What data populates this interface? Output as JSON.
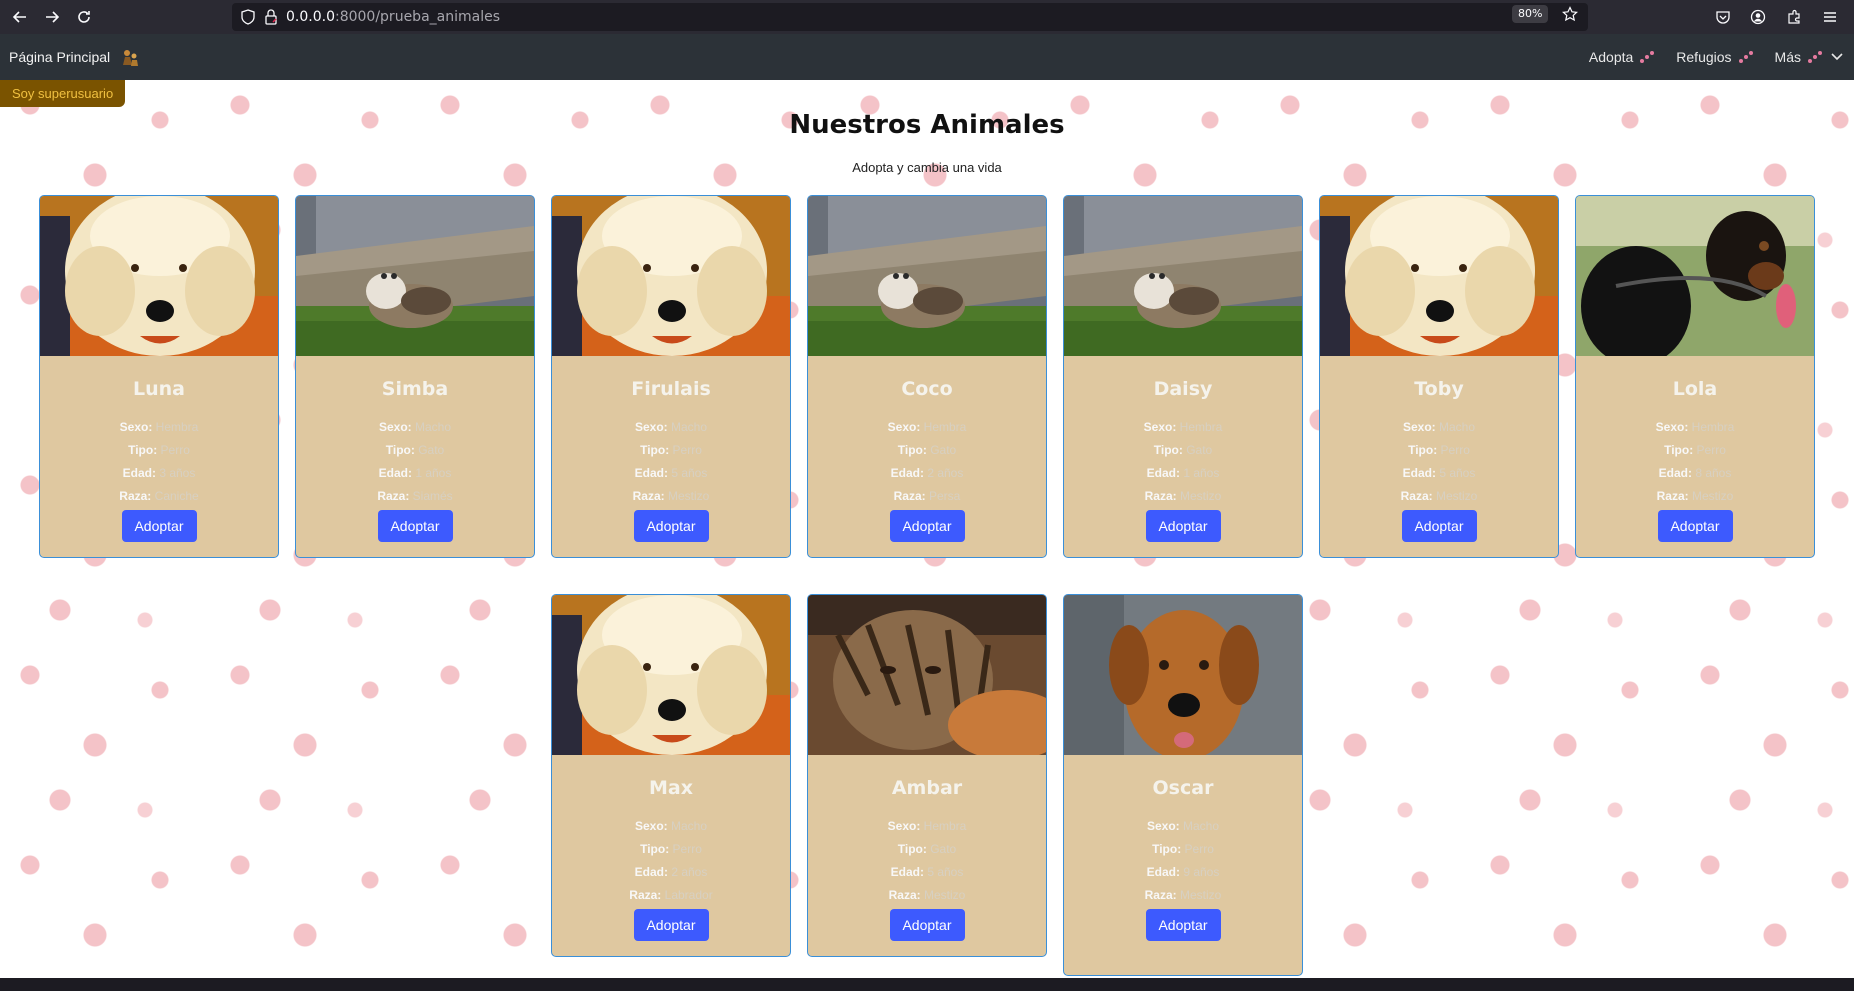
{
  "browser": {
    "url_host": "0.0.0.0",
    "url_path": ":8000/prueba_animales",
    "zoom": "80%"
  },
  "navbar": {
    "brand": "Página Principal",
    "links": [
      {
        "label": "Adopta"
      },
      {
        "label": "Refugios"
      },
      {
        "label": "Más"
      }
    ]
  },
  "page": {
    "superuser_badge": "Soy superusuario",
    "title": "Nuestros Animales",
    "subtitle": "Adopta y cambia una vida"
  },
  "labels": {
    "sexo": "Sexo:",
    "tipo": "Tipo:",
    "edad": "Edad:",
    "raza": "Raza:",
    "adopt_button": "Adoptar"
  },
  "animals": [
    {
      "name": "Luna",
      "sexo": "Hembra",
      "tipo": "Perro",
      "edad": "3 años",
      "raza": "Caniche"
    },
    {
      "name": "Simba",
      "sexo": "Macho",
      "tipo": "Gato",
      "edad": "1 años",
      "raza": "Siamés"
    },
    {
      "name": "Firulais",
      "sexo": "Macho",
      "tipo": "Perro",
      "edad": "5 años",
      "raza": "Mestizo"
    },
    {
      "name": "Coco",
      "sexo": "Hembra",
      "tipo": "Gato",
      "edad": "2 años",
      "raza": "Persa"
    },
    {
      "name": "Daisy",
      "sexo": "Hembra",
      "tipo": "Gato",
      "edad": "1 años",
      "raza": "Mestizo"
    },
    {
      "name": "Toby",
      "sexo": "Macho",
      "tipo": "Perro",
      "edad": "5 años",
      "raza": "Mestizo"
    },
    {
      "name": "Lola",
      "sexo": "Hembra",
      "tipo": "Perro",
      "edad": "8 años",
      "raza": "Mestizo"
    },
    {
      "name": "Max",
      "sexo": "Macho",
      "tipo": "Perro",
      "edad": "2 años",
      "raza": "Labrador"
    },
    {
      "name": "Ambar",
      "sexo": "Hembra",
      "tipo": "Gato",
      "edad": "5 años",
      "raza": "Mestizo"
    },
    {
      "name": "Oscar",
      "sexo": "Macho",
      "tipo": "Perro",
      "edad": "9 años",
      "raza": "Mestizo"
    }
  ],
  "colors": {
    "card_bg": "#dfc8a0",
    "card_border": "#3a8fd8",
    "button": "#3d5afe",
    "navbar": "#2c3238",
    "superuser_bg": "#7a5300"
  }
}
